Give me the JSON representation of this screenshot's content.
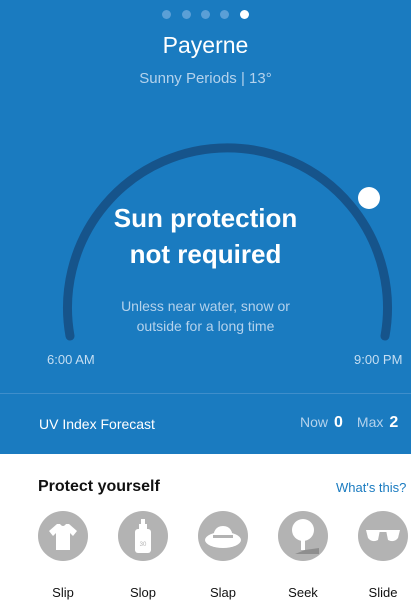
{
  "header": {
    "city": "Payerne",
    "conditions": "Sunny Periods | 13°"
  },
  "page_dots": {
    "count": 5,
    "active_index": 4
  },
  "status": {
    "headline_line1": "Sun protection",
    "headline_line2": "not required",
    "note_line1": "Unless near water, snow or",
    "note_line2": "outside for a long time"
  },
  "timeline": {
    "start": "6:00 AM",
    "end": "9:00 PM"
  },
  "uv": {
    "label": "UV Index Forecast",
    "now_label": "Now",
    "now_value": "0",
    "max_label": "Max",
    "max_value": "2"
  },
  "protect": {
    "title": "Protect yourself",
    "link": "What's this?",
    "items": [
      {
        "label": "Slip",
        "icon": "shirt-icon"
      },
      {
        "label": "Slop",
        "icon": "sunscreen-icon"
      },
      {
        "label": "Slap",
        "icon": "hat-icon"
      },
      {
        "label": "Seek",
        "icon": "shade-tree-icon"
      },
      {
        "label": "Slide",
        "icon": "sunglasses-icon"
      }
    ]
  },
  "colors": {
    "background": "#1a7bc0",
    "arc": "#16548b",
    "accent": "#1a7bc0",
    "icon_circle": "#b3b3b3"
  }
}
